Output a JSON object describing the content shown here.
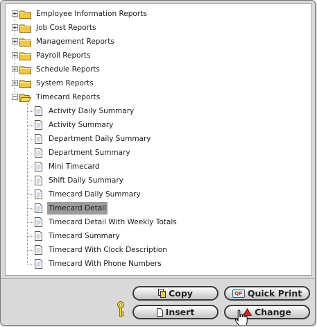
{
  "tree": {
    "items": [
      {
        "label": "Employee Information Reports",
        "type": "folder",
        "state": "collapsed"
      },
      {
        "label": "Job Cost Reports",
        "type": "folder",
        "state": "collapsed"
      },
      {
        "label": "Management Reports",
        "type": "folder",
        "state": "collapsed"
      },
      {
        "label": "Payroll Reports",
        "type": "folder",
        "state": "collapsed"
      },
      {
        "label": "Schedule Reports",
        "type": "folder",
        "state": "collapsed"
      },
      {
        "label": "System Reports",
        "type": "folder",
        "state": "collapsed"
      },
      {
        "label": "Timecard Reports",
        "type": "folder",
        "state": "expanded"
      }
    ],
    "timecard_children": [
      {
        "label": "Activity Daily Summary"
      },
      {
        "label": "Activity Summary"
      },
      {
        "label": "Department Daily Summary"
      },
      {
        "label": "Department Summary"
      },
      {
        "label": "Mini Timecard"
      },
      {
        "label": "Shift Daily Summary"
      },
      {
        "label": "Timecard Daily Summary"
      },
      {
        "label": "Timecard Detail",
        "selected": true
      },
      {
        "label": "Timecard Detail With Weekly Totals"
      },
      {
        "label": "Timecard Summary"
      },
      {
        "label": "Timecard With Clock Description"
      },
      {
        "label": "Timecard With Phone Numbers"
      }
    ]
  },
  "buttons": {
    "copy": "Copy",
    "quick_print": "Quick Print",
    "quick_print_badge": "QP",
    "insert": "Insert",
    "change": "Change"
  },
  "colors": {
    "selection": "#9c9c9c",
    "folder": "#f2c744",
    "change_triangle": "#d12a1c"
  }
}
